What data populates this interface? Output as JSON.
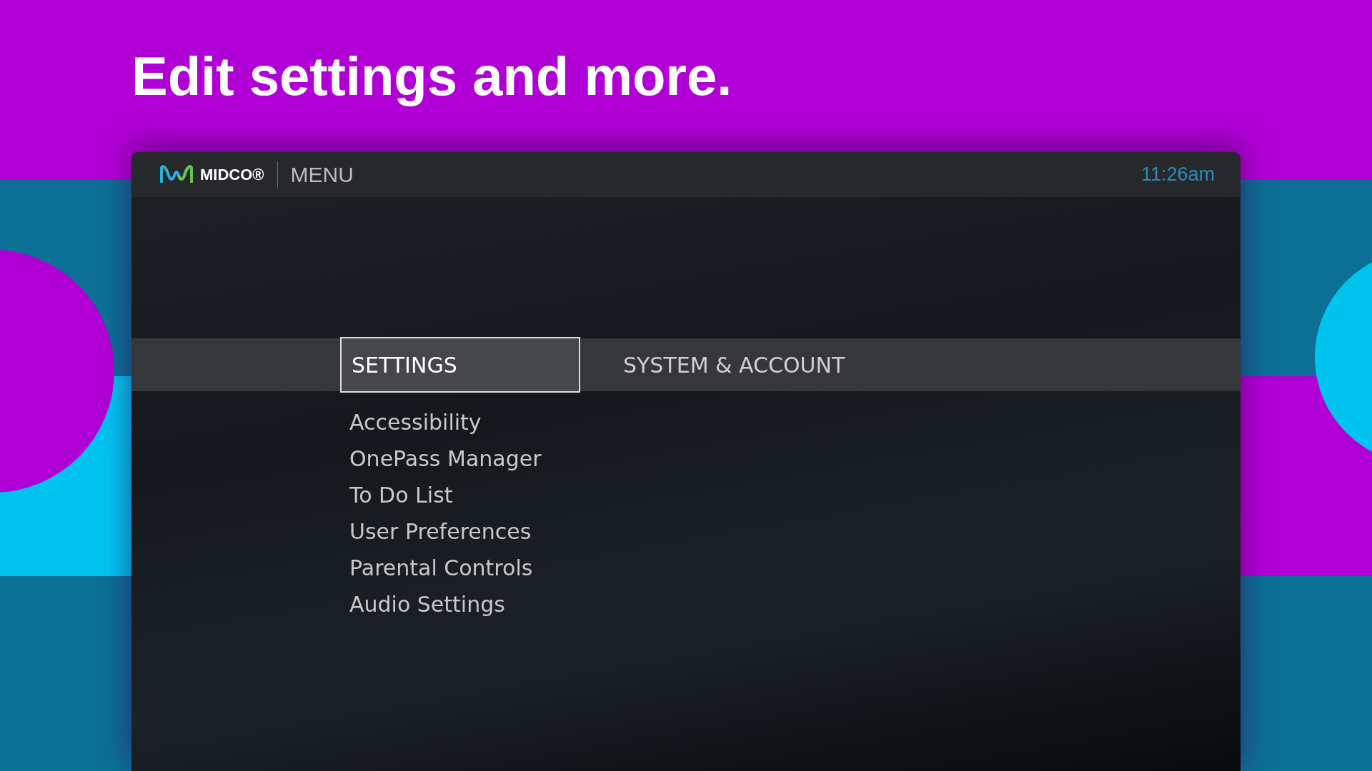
{
  "headline": "Edit settings and more.",
  "header": {
    "brand": "MIDCO®",
    "title": "MENU",
    "time": "11:26am"
  },
  "tabs": [
    {
      "label": "SETTINGS",
      "selected": true
    },
    {
      "label": "SYSTEM & ACCOUNT",
      "selected": false
    }
  ],
  "menu_items": [
    {
      "label": "Accessibility"
    },
    {
      "label": "OnePass Manager"
    },
    {
      "label": "To Do List"
    },
    {
      "label": "User Preferences"
    },
    {
      "label": "Parental Controls"
    },
    {
      "label": "Audio Settings"
    }
  ]
}
